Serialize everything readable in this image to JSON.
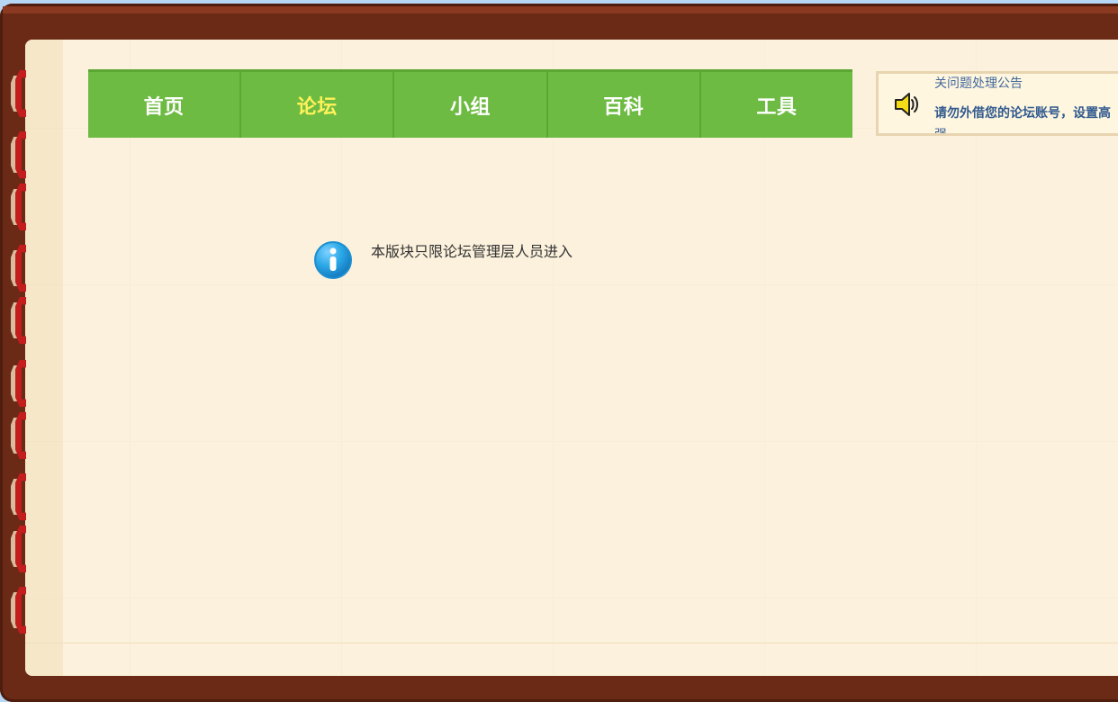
{
  "navigation": {
    "items": [
      {
        "label": "首页",
        "active": false
      },
      {
        "label": "论坛",
        "active": true
      },
      {
        "label": "小组",
        "active": false
      },
      {
        "label": "百科",
        "active": false
      },
      {
        "label": "工具",
        "active": false
      }
    ]
  },
  "announcement": {
    "icon": "speaker-icon",
    "previous_text": "关问题处理公告",
    "current_text": "请勿外借您的论坛账号，设置高",
    "next_text": "强"
  },
  "content": {
    "message_icon": "info-icon",
    "message": "本版块只限论坛管理层人员进入"
  },
  "colors": {
    "frame": "#6b2a15",
    "paper": "#fbf1dc",
    "nav_green": "#6dbb42",
    "active_nav_text": "#fff159",
    "notice_text": "#315a8e",
    "ring_red": "#c41d1d"
  }
}
